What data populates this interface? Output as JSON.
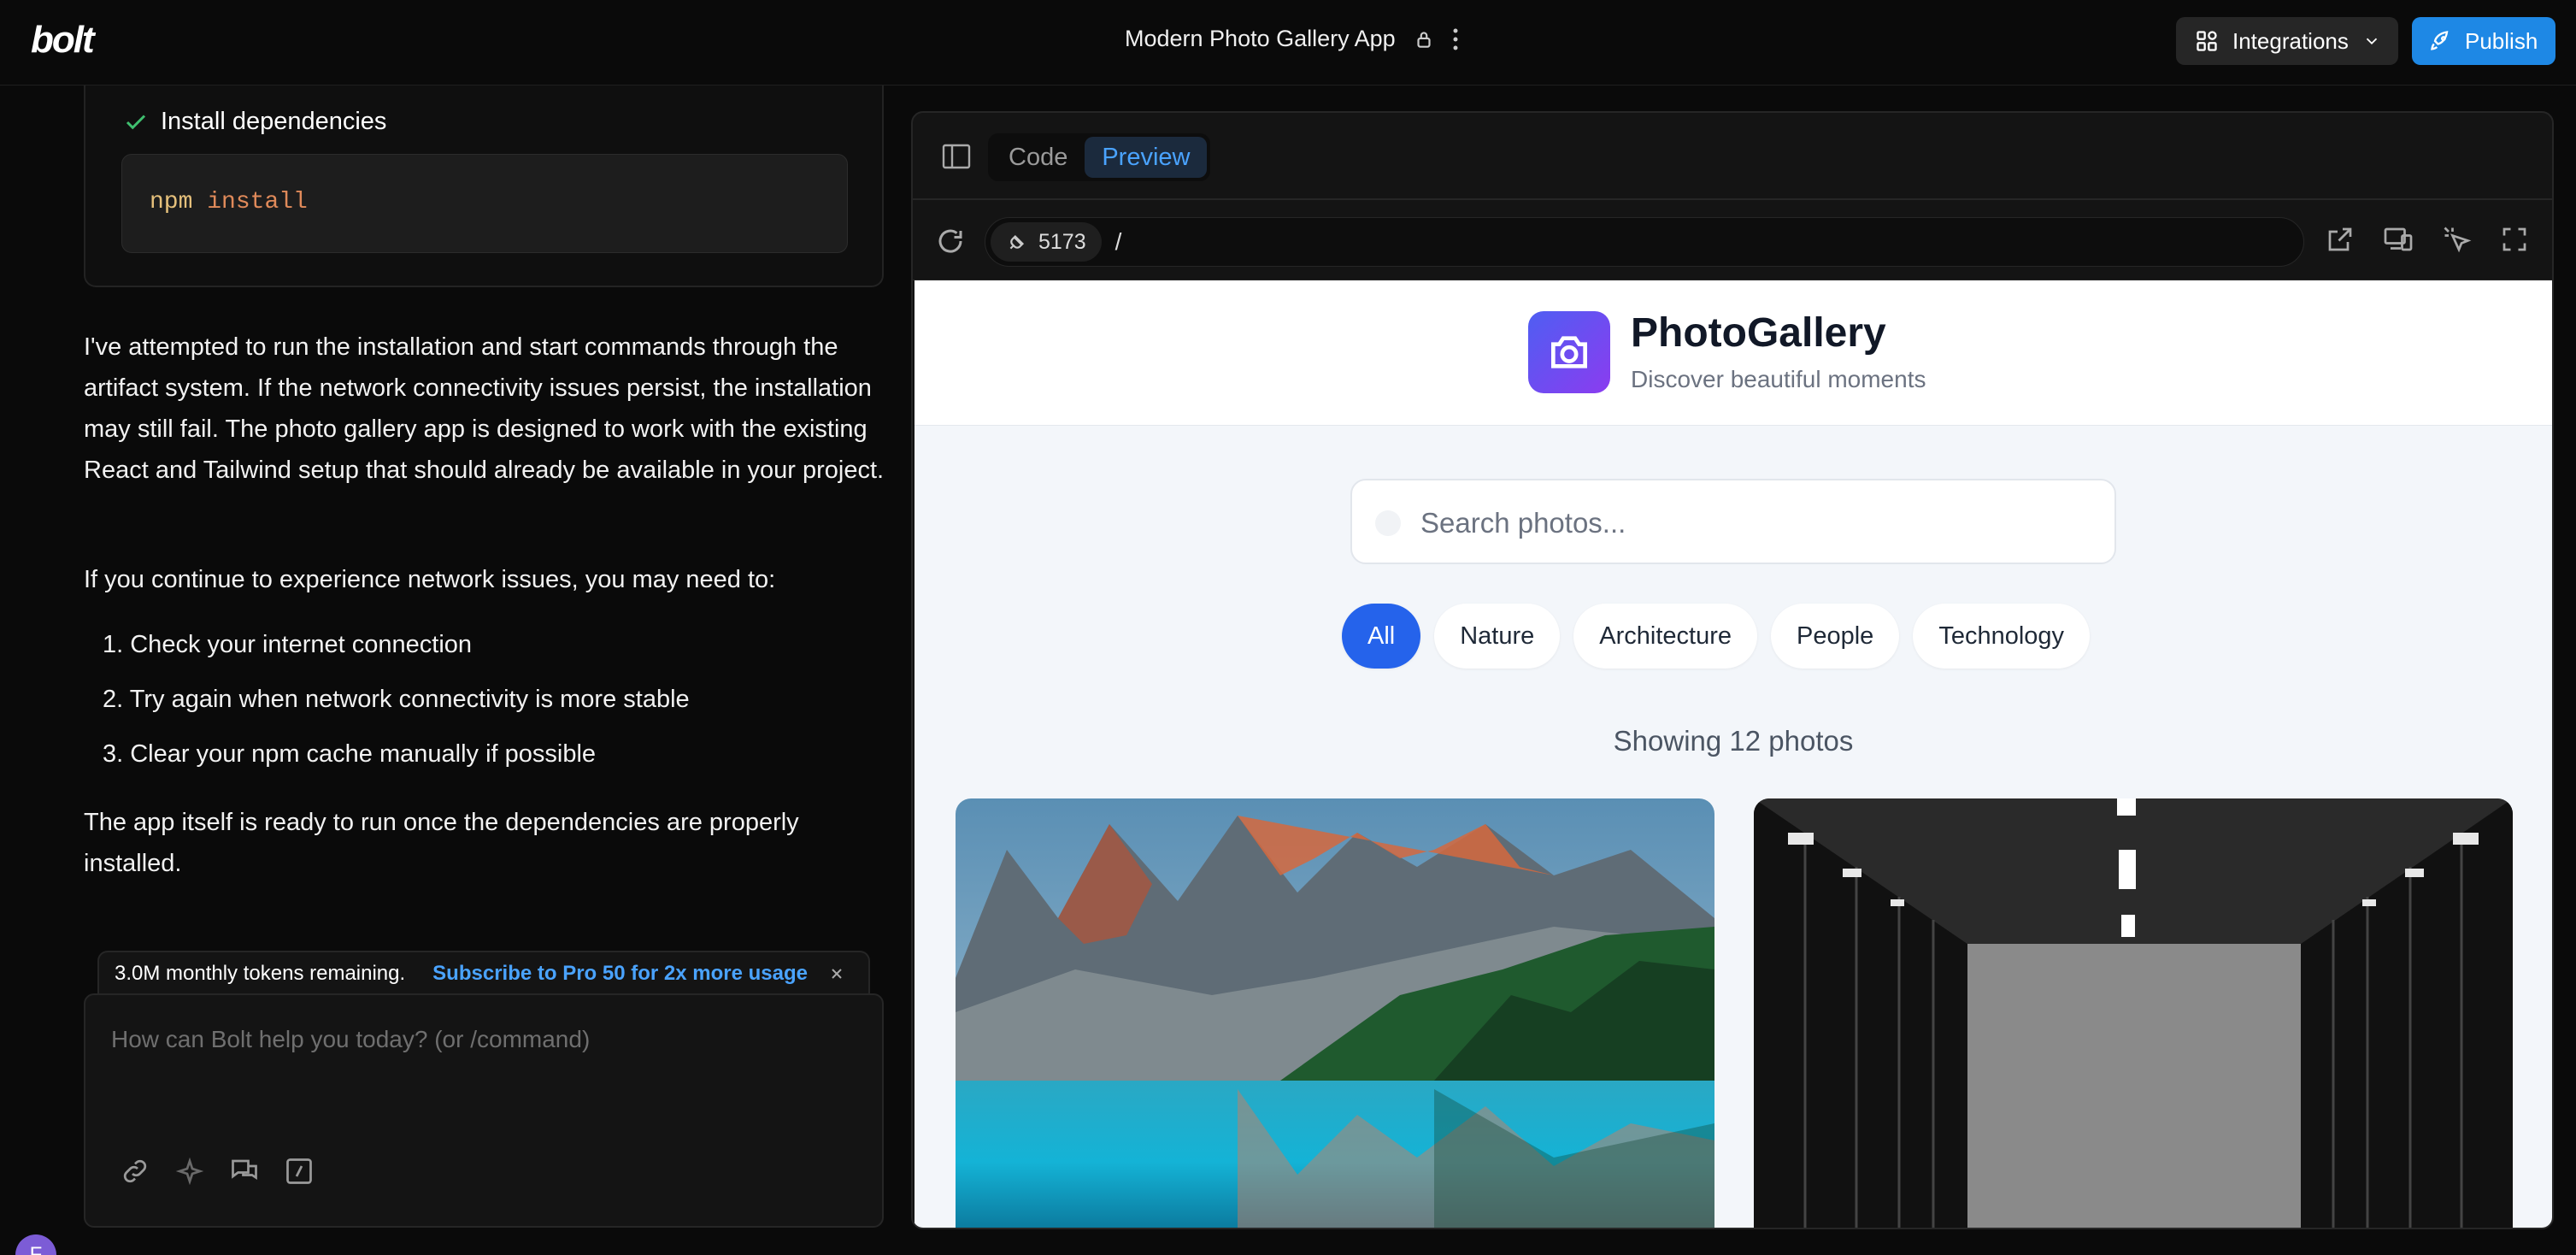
{
  "topbar": {
    "logo": "bolt",
    "project_title": "Modern Photo Gallery App",
    "integrations_label": "Integrations",
    "publish_label": "Publish"
  },
  "chat": {
    "step_label": "Install dependencies",
    "code": {
      "command": "npm",
      "argument": "install"
    },
    "paragraph1": "I've attempted to run the installation and start commands through the artifact system. If the network connectivity issues persist, the installation may still fail. The photo gallery app is designed to work with the existing React and Tailwind setup that should already be available in your project.",
    "paragraph2": "If you continue to experience network issues, you may need to:",
    "list": [
      "1. Check your internet connection",
      "2. Try again when network connectivity is more stable",
      "3. Clear your npm cache manually if possible"
    ],
    "paragraph3": "The app itself is ready to run once the dependencies are properly installed.",
    "tokens_text": "3.0M monthly tokens remaining.",
    "subscribe_text": "Subscribe to Pro 50 for 2x more usage",
    "input_placeholder": "How can Bolt help you today? (or /command)",
    "avatar_initial": "F"
  },
  "preview": {
    "tabs": [
      {
        "label": "Code"
      },
      {
        "label": "Preview"
      }
    ],
    "port": "5173",
    "path": "/"
  },
  "app": {
    "title": "PhotoGallery",
    "subtitle": "Discover beautiful moments",
    "search_placeholder": "Search photos...",
    "filters": [
      "All",
      "Nature",
      "Architecture",
      "People",
      "Technology"
    ],
    "count_text": "Showing 12 photos",
    "accent_color": "#2563eb"
  }
}
